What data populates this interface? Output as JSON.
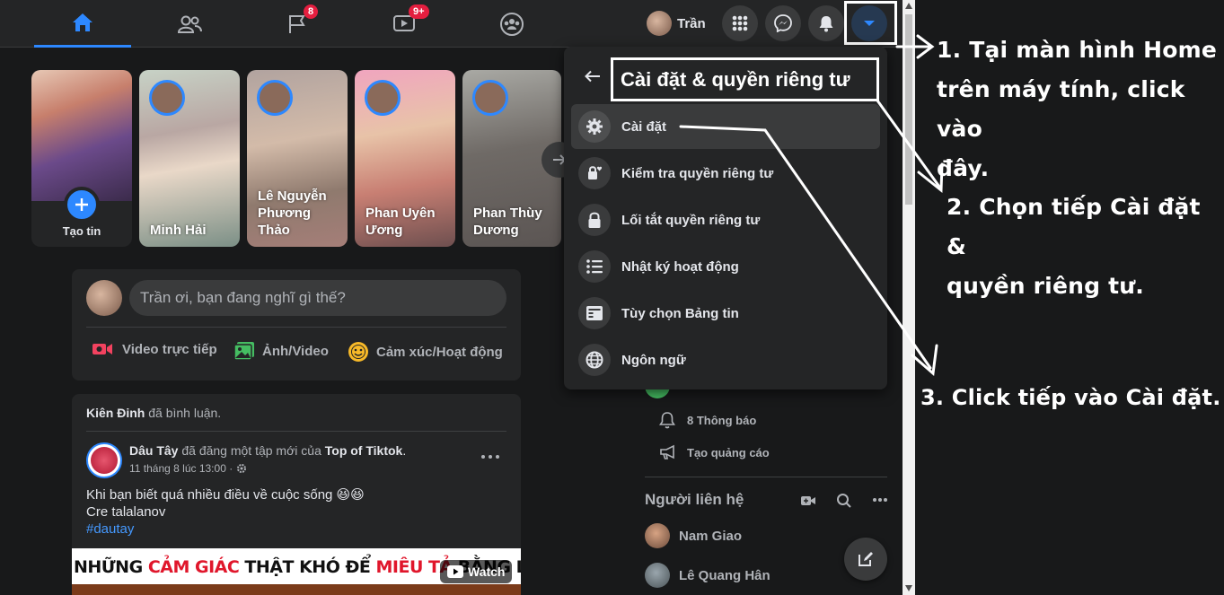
{
  "nav": {
    "groups_badge": "8",
    "watch_badge": "9+",
    "profile_name": "Trần"
  },
  "stories": [
    {
      "label": "Tạo tin"
    },
    {
      "label": "Minh Hải"
    },
    {
      "label": "Lê Nguyễn Phương Thảo"
    },
    {
      "label": "Phan Uyên Ương"
    },
    {
      "label": "Phan Thùy Dương"
    }
  ],
  "composer": {
    "placeholder": "Trần ơi, bạn đang nghĩ gì thế?",
    "actions": [
      "Video trực tiếp",
      "Ảnh/Video",
      "Cảm xúc/Hoạt động"
    ]
  },
  "post": {
    "activity_name": "Kiên Đinh",
    "activity_text": "đã bình luận.",
    "author": "Dâu Tây",
    "mid_text": "đã đăng một tập mới của",
    "page": "Top of Tiktok",
    "page_suffix": ".",
    "time": "11 tháng 8 lúc 13:00 ·",
    "line1": "Khi bạn biết quá nhiều điều về cuộc sống 😆😆",
    "line2": "Cre talalanov",
    "hashtag": "#dautay",
    "banner_w1": "NHỮNG",
    "banner_w2": "CẢM GIÁC",
    "banner_w3": "THẬT KHÓ ĐỂ",
    "banner_w4": "MIÊU TẢ",
    "banner_w5": "BẰNG LỜI",
    "watch_label": "Watch"
  },
  "menu": {
    "title": "Cài đặt & quyền riêng tư",
    "items": [
      {
        "label": "Cài đặt",
        "icon": "gear-icon"
      },
      {
        "label": "Kiểm tra quyền riêng tư",
        "icon": "lock-heart-icon"
      },
      {
        "label": "Lối tắt quyền riêng tư",
        "icon": "lock-icon"
      },
      {
        "label": "Nhật ký hoạt động",
        "icon": "list-icon"
      },
      {
        "label": "Tùy chọn Bảng tin",
        "icon": "news-feed-icon"
      },
      {
        "label": "Ngôn ngữ",
        "icon": "globe-icon"
      }
    ]
  },
  "right": {
    "notifications": "8 Thông báo",
    "create_ad": "Tạo quảng cáo",
    "contacts_title": "Người liên hệ",
    "contacts": [
      "Nam Giao",
      "Lê Quang Hân"
    ]
  },
  "annotations": {
    "step1_l1": "1. Tại màn hình Home",
    "step1_l2": "trên máy tính, click vào",
    "step1_l3": "đây.",
    "step2_l1": "2. Chọn tiếp Cài đặt &",
    "step2_l2": "quyền riêng tư.",
    "step3": "3. Click tiếp vào Cài đặt."
  },
  "colors": {
    "accent": "#2d88ff",
    "background": "#18191a",
    "surface": "#242526",
    "badge": "#e41e3f"
  }
}
